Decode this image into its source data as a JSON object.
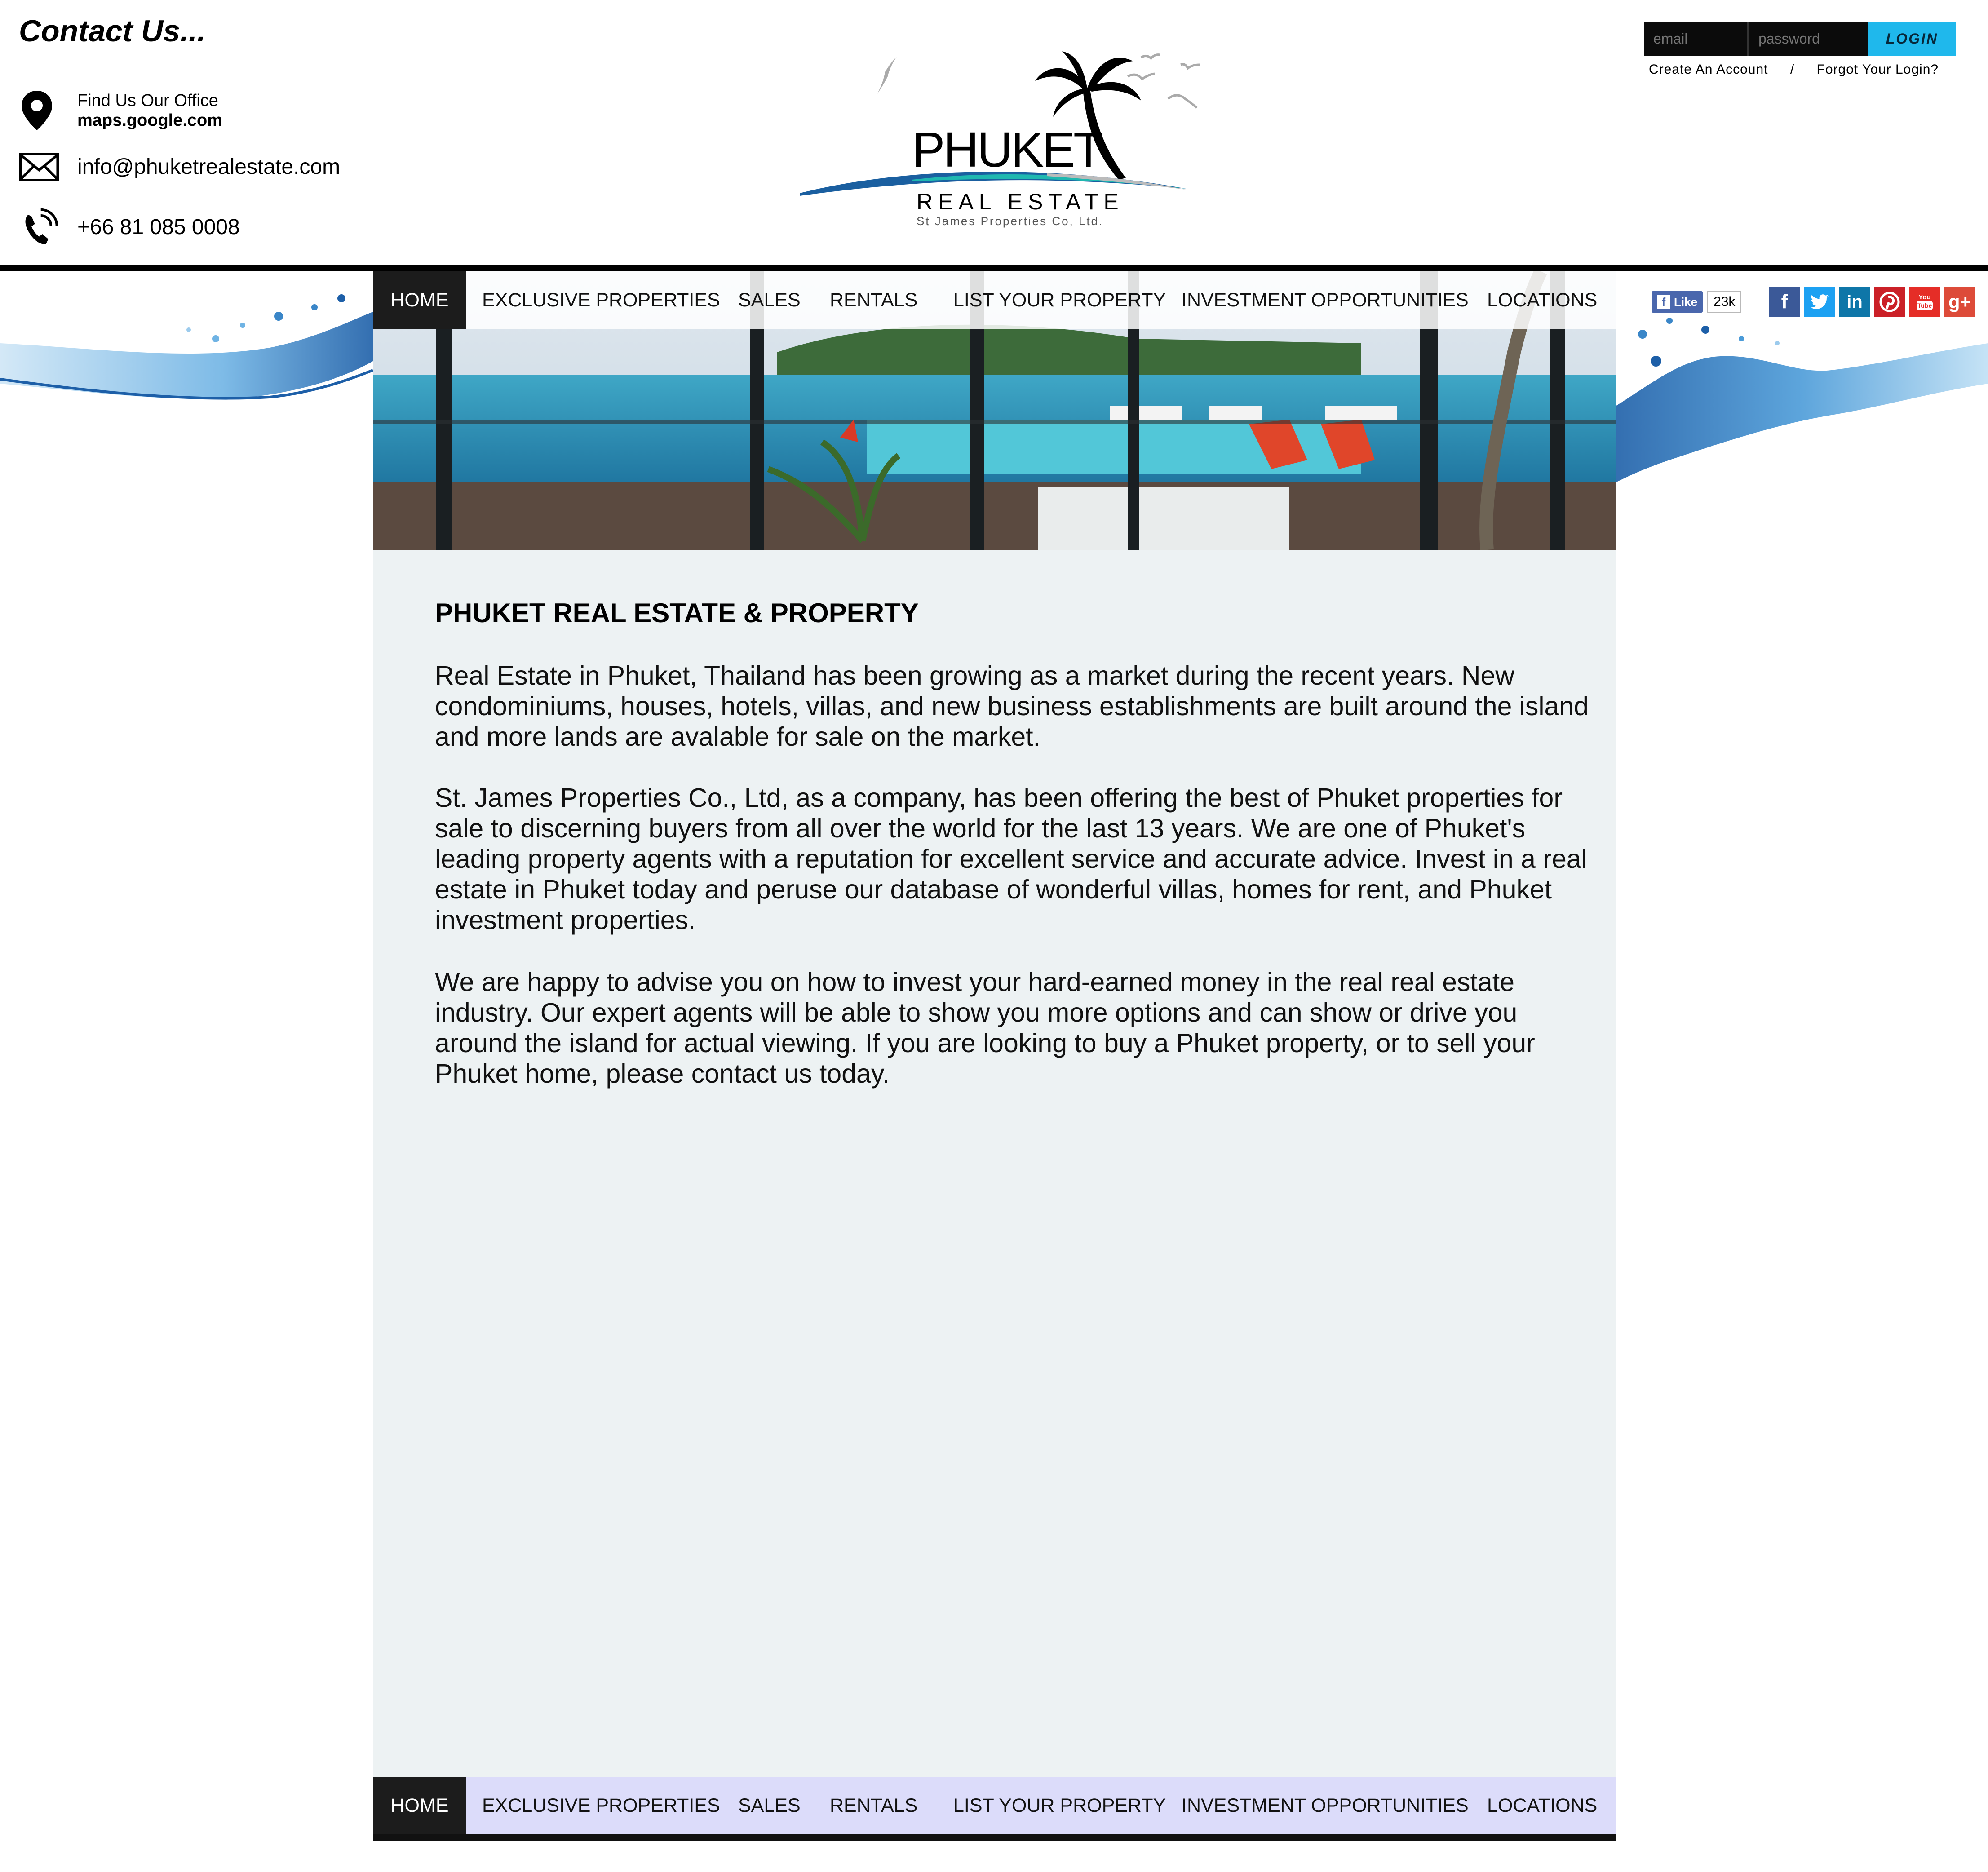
{
  "contact": {
    "title": "Contact Us...",
    "office_label": "Find Us Our Office",
    "office_link": "maps.google.com",
    "email": "info@phuketrealestate.com",
    "phone": "+66 81 085 0008"
  },
  "logo": {
    "word": "PHUKET",
    "subtitle": "REAL ESTATE",
    "company": "St James Properties Co, Ltd."
  },
  "login": {
    "email_placeholder": "email",
    "password_placeholder": "password",
    "button_label": "LOGIN",
    "create_account": "Create An Account",
    "separator": "/",
    "forgot": "Forgot Your Login?"
  },
  "nav": {
    "items": [
      "HOME",
      "EXCLUSIVE PROPERTIES",
      "SALES",
      "RENTALS",
      "LIST YOUR PROPERTY",
      "INVESTMENT OPPORTUNITIES",
      "LOCATIONS"
    ],
    "active": "HOME"
  },
  "social": {
    "like_label": "Like",
    "like_count": "23k",
    "icons": [
      "facebook-icon",
      "twitter-icon",
      "linkedin-icon",
      "pinterest-icon",
      "youtube-icon",
      "google-plus-icon"
    ],
    "colors": {
      "facebook": "#3b5998",
      "twitter": "#1da1f2",
      "linkedin": "#0e76a8",
      "pinterest": "#cb2027",
      "youtube": "#e52d27",
      "google_plus": "#dd4b39"
    }
  },
  "content": {
    "heading": "PHUKET REAL ESTATE & PROPERTY",
    "paragraphs": [
      "Real Estate in Phuket, Thailand has been growing as a market during the recent years. New condominiums, houses, hotels, villas, and new business establishments are built around the island and more lands are avalable for sale on the market.",
      "St. James Properties Co., Ltd, as a company, has been offering the best of Phuket properties for sale to discerning buyers from all over the world for the last 13 years. We are one of Phuket's leading property agents with a reputation for excellent service and accurate advice. Invest in a real estate in Phuket today and peruse our database of wonderful villas, homes for rent, and Phuket investment properties.",
      "We are happy to advise you on how to invest your hard-earned money in the real real estate industry. Our expert agents will be able to show you more options and can show or drive you around the island for actual viewing. If you are looking to buy a Phuket property, or to sell your Phuket home, please contact us today."
    ]
  },
  "colors": {
    "login_accent": "#1fb8ec",
    "nav_active_bg": "#1c1c1c",
    "content_bg": "#edf2f3",
    "bottom_nav_bg": "#dcdcfa"
  }
}
